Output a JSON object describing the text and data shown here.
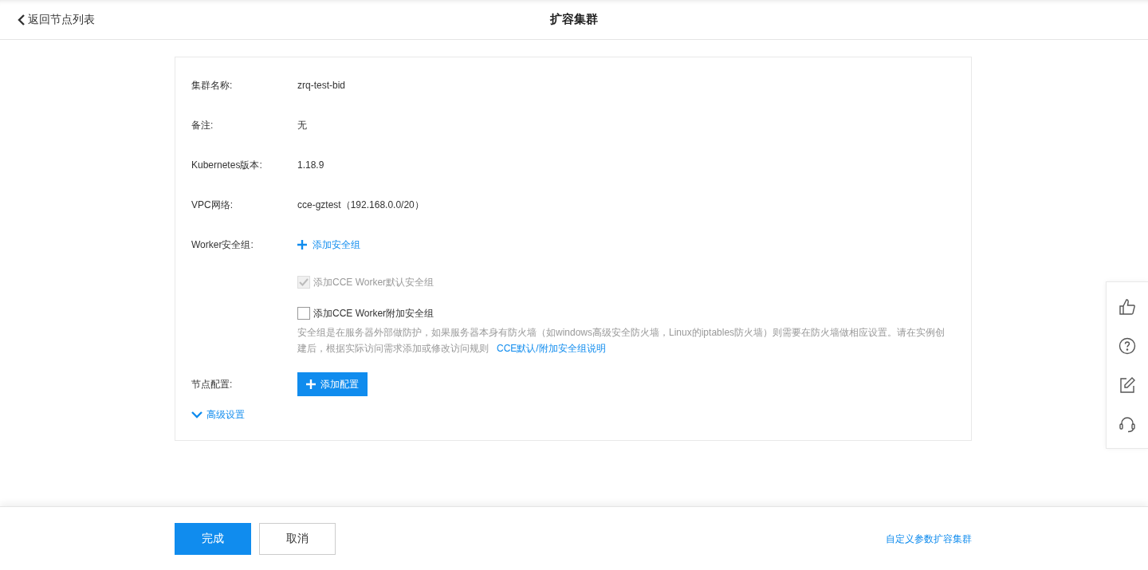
{
  "header": {
    "back_label": "返回节点列表",
    "title": "扩容集群"
  },
  "fields": [
    {
      "kind": "text",
      "label": "集群名称:",
      "value": "zrq-test-bid"
    },
    {
      "kind": "text",
      "label": "备注:",
      "value": "无"
    },
    {
      "kind": "text",
      "label": "Kubernetes版本:",
      "value": "1.18.9"
    },
    {
      "kind": "text",
      "label": "VPC网络:",
      "value": "cce-gztest（192.168.0.0/20）"
    },
    {
      "kind": "add_link",
      "label": "Worker安全组:",
      "value": "添加安全组"
    }
  ],
  "security_options": [
    {
      "label": "添加CCE Worker默认安全组",
      "checked": true,
      "disabled": true
    },
    {
      "label": "添加CCE Worker附加安全组",
      "checked": false,
      "disabled": false
    }
  ],
  "security_hint": {
    "text": "安全组是在服务器外部做防护，如果服务器本身有防火墙（如windows高级安全防火墙，Linux的iptables防火墙）则需要在防火墙做相应设置。请在实例创建后，根据实际访问需求添加或修改访问规则",
    "link": "CCE默认/附加安全组说明"
  },
  "node_config": {
    "label": "节点配置:",
    "button": "添加配置"
  },
  "advanced": {
    "label": "高级设置",
    "expanded": false
  },
  "footer": {
    "buttons": [
      {
        "label": "完成",
        "kind": "primary"
      },
      {
        "label": "取消",
        "kind": "secondary"
      }
    ],
    "link": "自定义参数扩容集群"
  }
}
